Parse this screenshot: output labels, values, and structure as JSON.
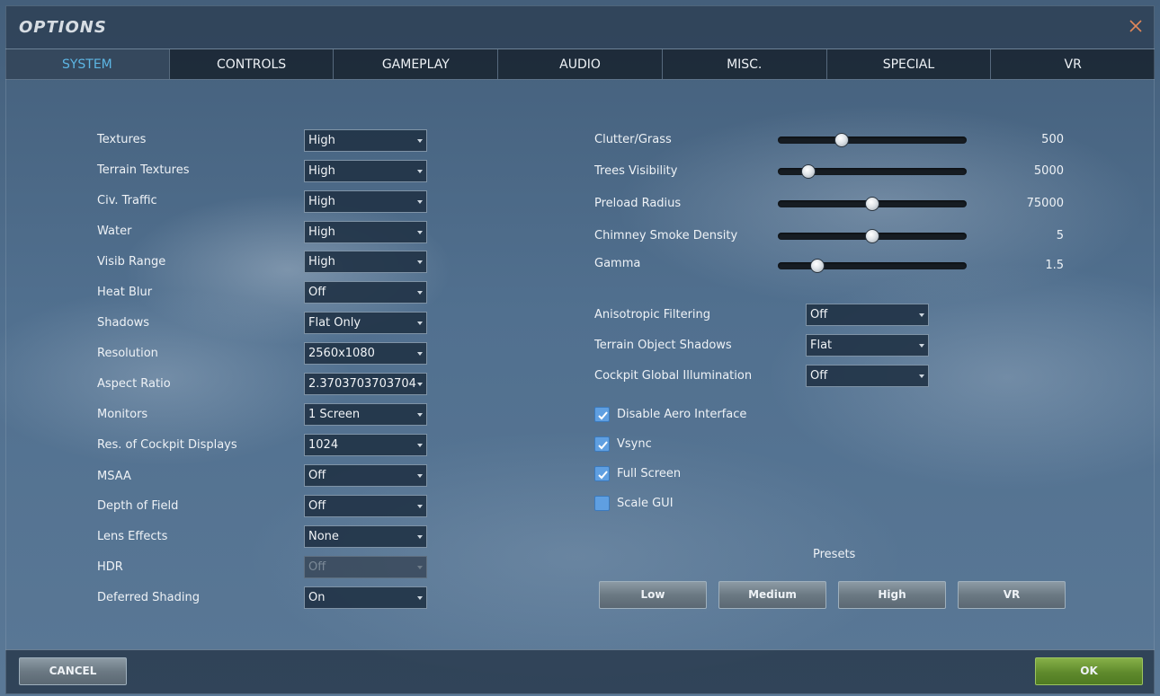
{
  "window": {
    "title": "OPTIONS"
  },
  "tabs": [
    {
      "label": "SYSTEM",
      "active": true
    },
    {
      "label": "CONTROLS",
      "active": false
    },
    {
      "label": "GAMEPLAY",
      "active": false
    },
    {
      "label": "AUDIO",
      "active": false
    },
    {
      "label": "MISC.",
      "active": false
    },
    {
      "label": "SPECIAL",
      "active": false
    },
    {
      "label": "VR",
      "active": false
    }
  ],
  "left_settings": [
    {
      "label": "Textures",
      "value": "High"
    },
    {
      "label": "Terrain Textures",
      "value": "High"
    },
    {
      "label": "Civ. Traffic",
      "value": "High"
    },
    {
      "label": "Water",
      "value": "High"
    },
    {
      "label": "Visib Range",
      "value": "High"
    },
    {
      "label": "Heat Blur",
      "value": "Off"
    },
    {
      "label": "Shadows",
      "value": "Flat Only"
    },
    {
      "label": "Resolution",
      "value": "2560x1080"
    },
    {
      "label": "Aspect Ratio",
      "value": "2.3703703703704"
    },
    {
      "label": "Monitors",
      "value": "1 Screen"
    },
    {
      "label": "Res. of Cockpit Displays",
      "value": "1024"
    },
    {
      "label": "MSAA",
      "value": "Off"
    },
    {
      "label": "Depth of Field",
      "value": "Off"
    },
    {
      "label": "Lens Effects",
      "value": "None"
    },
    {
      "label": "HDR",
      "value": "Off",
      "disabled": true
    },
    {
      "label": "Deferred Shading",
      "value": "On"
    }
  ],
  "sliders": [
    {
      "label": "Clutter/Grass",
      "value": "500",
      "position": 0.34
    },
    {
      "label": "Trees Visibility",
      "value": "5000",
      "position": 0.16
    },
    {
      "label": "Preload Radius",
      "value": "75000",
      "position": 0.5
    },
    {
      "label": "Chimney Smoke Density",
      "value": "5",
      "position": 0.5
    },
    {
      "label": "Gamma",
      "value": "1.5",
      "position": 0.21
    }
  ],
  "right_settings": [
    {
      "label": "Anisotropic Filtering",
      "value": "Off"
    },
    {
      "label": "Terrain Object Shadows",
      "value": "Flat"
    },
    {
      "label": "Cockpit Global Illumination",
      "value": "Off"
    }
  ],
  "checkboxes": [
    {
      "label": "Disable Aero Interface",
      "checked": true
    },
    {
      "label": "Vsync",
      "checked": true
    },
    {
      "label": "Full Screen",
      "checked": true
    },
    {
      "label": "Scale GUI",
      "checked": false
    }
  ],
  "presets": {
    "label": "Presets",
    "buttons": [
      "Low",
      "Medium",
      "High",
      "VR"
    ]
  },
  "footer": {
    "cancel_label": "CANCEL",
    "ok_label": "OK"
  },
  "colors": {
    "active_tab": "#5db6e4",
    "checkbox": "#5f9fe1",
    "ok_button": "#5f8a2c"
  }
}
